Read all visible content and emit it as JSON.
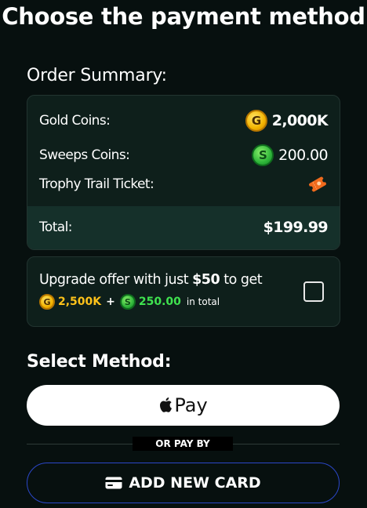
{
  "page": {
    "title": "Choose the payment method"
  },
  "order_summary": {
    "title": "Order Summary:",
    "rows": [
      {
        "label": "Gold Coins:",
        "value": "2,000K",
        "icon": "gold-coin-icon"
      },
      {
        "label": "Sweeps Coins:",
        "value": "200.00",
        "icon": "sweeps-coin-icon"
      },
      {
        "label": "Trophy Trail Ticket:",
        "value": "",
        "icon": "ticket-icon"
      }
    ],
    "total_label": "Total:",
    "total_value": "$199.99"
  },
  "upgrade": {
    "text_before": "Upgrade offer with just ",
    "amount": "$50",
    "text_after": " to get",
    "gold_value": "2,500K",
    "plus": "+",
    "sweeps_value": "250.00",
    "suffix": "in total",
    "checked": false
  },
  "select_method": {
    "title": "Select Method:",
    "apple_pay_label": "Pay",
    "or_label": "OR PAY BY",
    "add_card_label": "ADD NEW CARD"
  },
  "colors": {
    "background": "#07100f",
    "card": "#0e1f1b",
    "total_strip": "#15302a",
    "gold": "#ffc21a",
    "green": "#3fe24f",
    "outline_blue": "#2b47c8"
  }
}
